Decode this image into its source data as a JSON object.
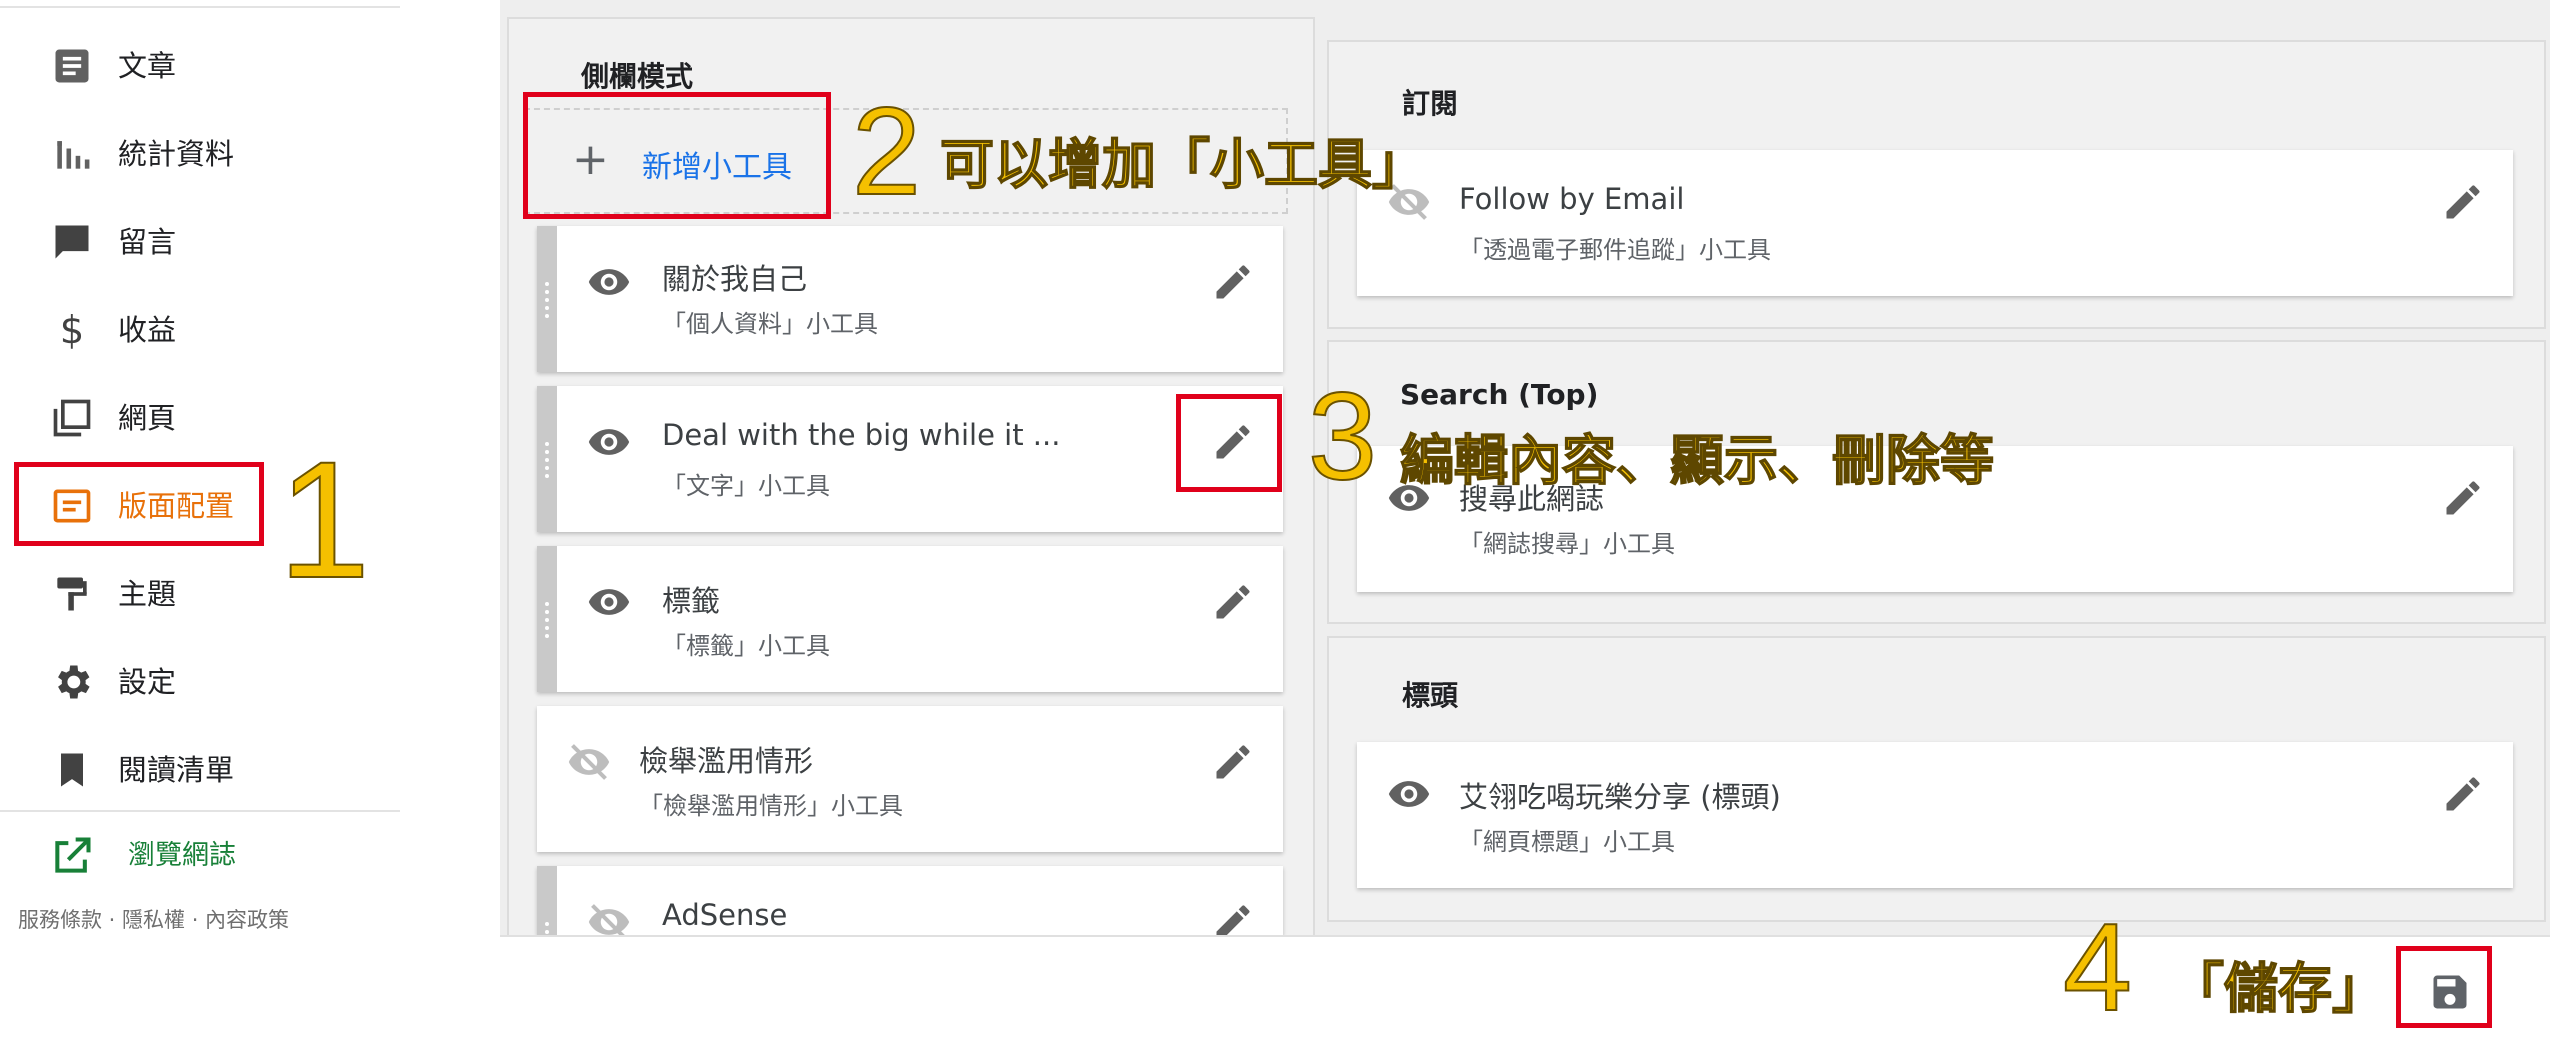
{
  "sidebar": {
    "items": [
      {
        "label": "文章",
        "icon": "posts-icon"
      },
      {
        "label": "統計資料",
        "icon": "stats-icon"
      },
      {
        "label": "留言",
        "icon": "comment-icon"
      },
      {
        "label": "收益",
        "icon": "dollar-icon"
      },
      {
        "label": "網頁",
        "icon": "pages-icon"
      },
      {
        "label": "版面配置",
        "icon": "layout-icon",
        "active": true
      },
      {
        "label": "主題",
        "icon": "paint-roller-icon"
      },
      {
        "label": "設定",
        "icon": "gear-icon"
      },
      {
        "label": "閱讀清單",
        "icon": "bookmark-icon"
      }
    ],
    "view_blog": {
      "label": "瀏覽網誌",
      "icon": "open-external-icon"
    },
    "footer": "服務條款 · 隱私權 · 內容政策"
  },
  "sidebar_section": {
    "title": "側欄模式",
    "add_widget_label": "新增小工具",
    "widgets": [
      {
        "title": "關於我自己",
        "subtitle": "「個人資料」小工具",
        "visible": true,
        "draggable": true
      },
      {
        "title": "Deal with the big while it ...",
        "subtitle": "「文字」小工具",
        "visible": true,
        "draggable": true
      },
      {
        "title": "標籤",
        "subtitle": "「標籤」小工具",
        "visible": true,
        "draggable": true
      },
      {
        "title": "檢舉濫用情形",
        "subtitle": "「檢舉濫用情形」小工具",
        "visible": false,
        "draggable": false
      },
      {
        "title": "AdSense",
        "subtitle": "",
        "visible": false,
        "draggable": true
      }
    ]
  },
  "right_sections": [
    {
      "title": "訂閱",
      "widget": {
        "title": "Follow by Email",
        "subtitle": "「透過電子郵件追蹤」小工具",
        "visible": false
      }
    },
    {
      "title": "Search (Top)",
      "widget": {
        "title": "搜尋此網誌",
        "subtitle": "「網誌搜尋」小工具",
        "visible": true
      }
    },
    {
      "title": "標頭",
      "widget": {
        "title": "艾翎吃喝玩樂分享 (標頭)",
        "subtitle": "「網頁標題」小工具",
        "visible": true
      }
    }
  ],
  "annotations": {
    "n1": "1",
    "n2": "2",
    "t2": "可以增加「小工具」",
    "n3": "3",
    "t3": "編輯內容、顯示、刪除等",
    "n4": "4",
    "t4": "「儲存」"
  },
  "colors": {
    "active": "#e8710a",
    "link": "#1a73e8",
    "annotation": "#f5c000",
    "highlight": "#e0001b"
  }
}
